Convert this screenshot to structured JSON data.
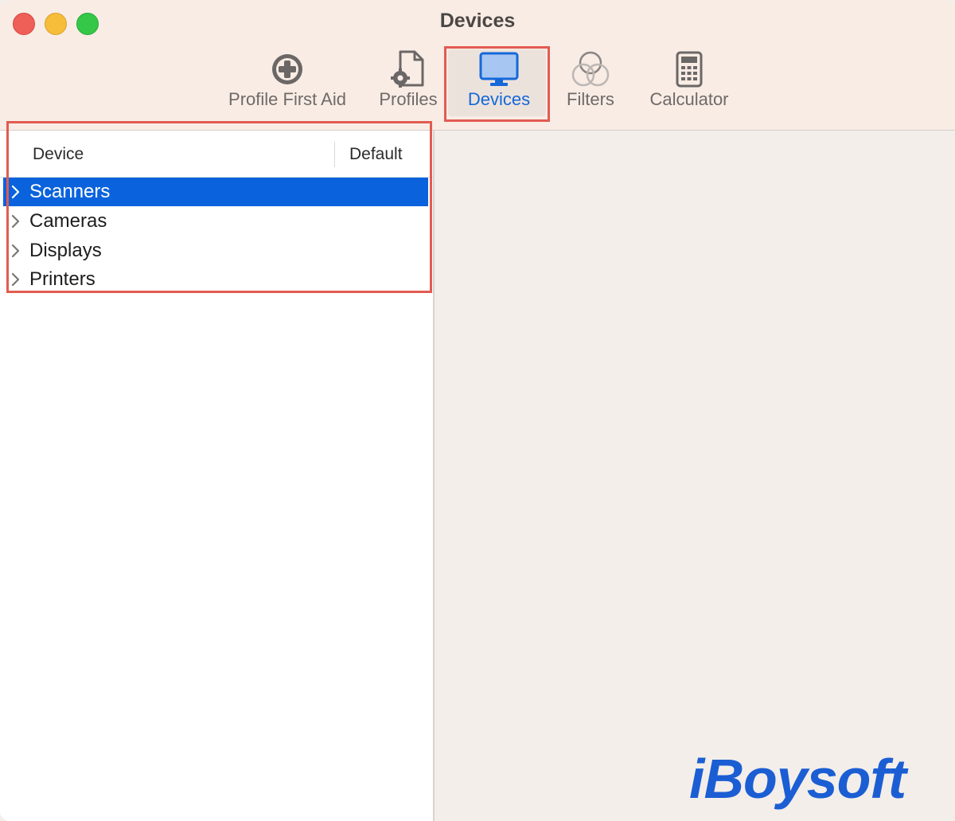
{
  "window": {
    "title": "Devices"
  },
  "toolbar": {
    "items": [
      {
        "label": "Profile First Aid",
        "icon": "plus-circle-icon"
      },
      {
        "label": "Profiles",
        "icon": "profile-document-gear-icon"
      },
      {
        "label": "Devices",
        "icon": "monitor-icon",
        "selected": true
      },
      {
        "label": "Filters",
        "icon": "overlapping-circles-icon"
      },
      {
        "label": "Calculator",
        "icon": "calculator-icon"
      }
    ]
  },
  "device_list": {
    "columns": [
      "Device",
      "Default"
    ],
    "rows": [
      {
        "label": "Scanners",
        "selected": true
      },
      {
        "label": "Cameras",
        "selected": false
      },
      {
        "label": "Displays",
        "selected": false
      },
      {
        "label": "Printers",
        "selected": false
      }
    ]
  },
  "watermark": {
    "text": "iBoysoft"
  },
  "colors": {
    "accent": "#0a63dc",
    "highlight_box": "#e25b52",
    "titlebar_bg": "#f8ece5",
    "content_bg": "#f3eeea"
  }
}
